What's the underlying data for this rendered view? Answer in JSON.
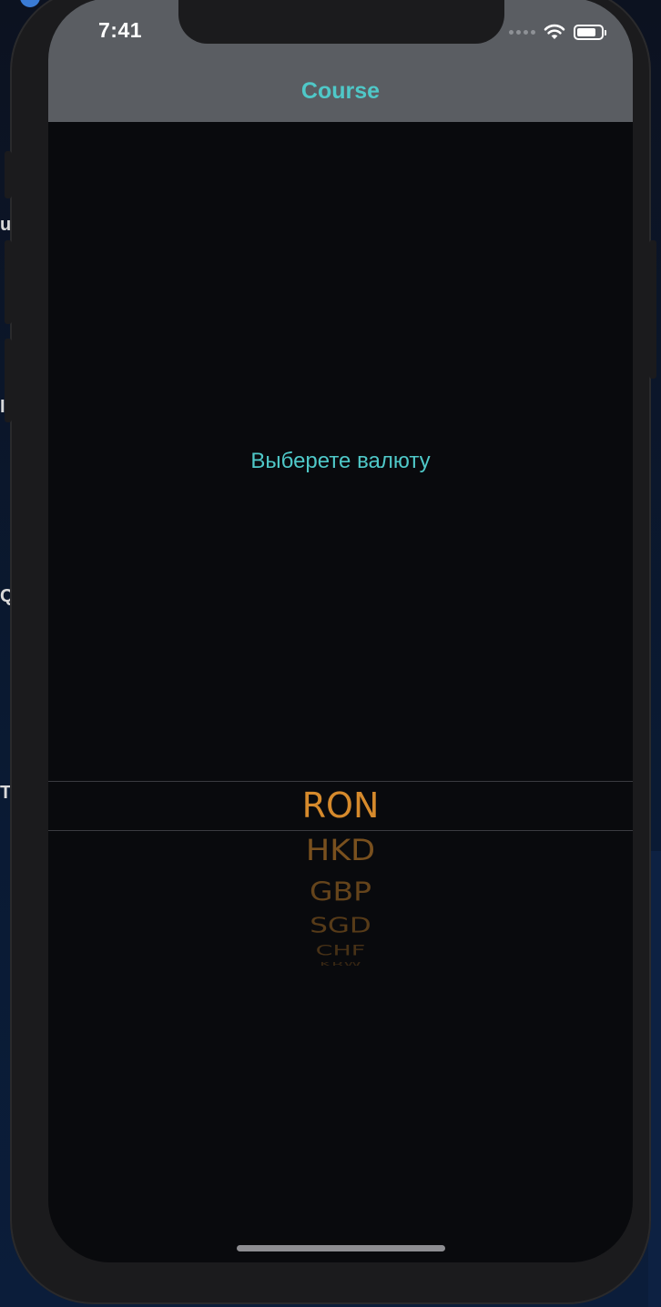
{
  "status_bar": {
    "time": "7:41"
  },
  "nav": {
    "title": "Course"
  },
  "main": {
    "prompt": "Выберете валюту"
  },
  "picker": {
    "selected": "RON",
    "options_below": [
      "HKD",
      "GBP",
      "SGD",
      "CHF",
      "KRW"
    ]
  },
  "background_fragments": [
    "u",
    "I",
    "Q",
    "Te"
  ],
  "colors": {
    "accent_teal": "#4fc8c8",
    "picker_orange": "#d68a2c",
    "navbar": "#5a5d62",
    "screen_bg": "#090a0d"
  },
  "icons": [
    "cellular-signal-icon",
    "wifi-icon",
    "battery-icon"
  ]
}
